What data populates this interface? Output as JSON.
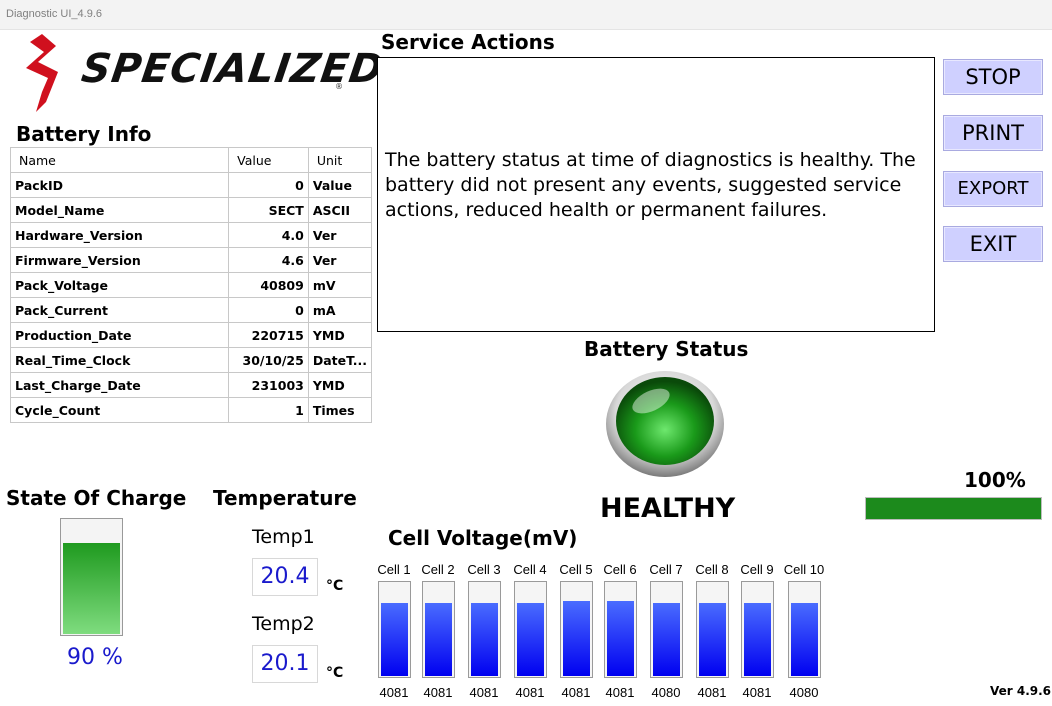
{
  "window": {
    "title": "Diagnostic UI_4.9.6"
  },
  "brand": {
    "name": "SPECIALIZED",
    "trademark": "®"
  },
  "battery_info": {
    "title": "Battery Info",
    "columns": [
      "Name",
      "Value",
      "Unit"
    ],
    "rows": [
      {
        "name": "PackID",
        "value": "0",
        "unit": "Value"
      },
      {
        "name": "Model_Name",
        "value": "SECT",
        "unit": "ASCII"
      },
      {
        "name": "Hardware_Version",
        "value": "4.0",
        "unit": "Ver"
      },
      {
        "name": "Firmware_Version",
        "value": "4.6",
        "unit": "Ver"
      },
      {
        "name": "Pack_Voltage",
        "value": "40809",
        "unit": "mV"
      },
      {
        "name": "Pack_Current",
        "value": "0",
        "unit": "mA"
      },
      {
        "name": "Production_Date",
        "value": "220715",
        "unit": "YMD"
      },
      {
        "name": "Real_Time_Clock",
        "value": "30/10/25",
        "unit": "DateT..."
      },
      {
        "name": "Last_Charge_Date",
        "value": "231003",
        "unit": "YMD"
      },
      {
        "name": "Cycle_Count",
        "value": "1",
        "unit": "Times"
      }
    ]
  },
  "service_actions": {
    "title": "Service Actions",
    "text": "The battery status at time of diagnostics is healthy. The battery did not present any events, suggested service actions, reduced health or permanent failures."
  },
  "buttons": {
    "stop": "STOP",
    "print": "PRINT",
    "export": "EXPORT",
    "exit": "EXIT"
  },
  "battery_status": {
    "title": "Battery Status",
    "state": "HEALTHY",
    "light_color": "#1a9a1a"
  },
  "progress": {
    "label": "100%",
    "value": 1.0,
    "color": "#1c8a1c"
  },
  "state_of_charge": {
    "title": "State Of Charge",
    "label": "90 %",
    "value": 0.9
  },
  "temperature": {
    "title": "Temperature",
    "sensors": [
      {
        "label": "Temp1",
        "value": "20.4",
        "unit": "°C"
      },
      {
        "label": "Temp2",
        "value": "20.1",
        "unit": "°C"
      }
    ]
  },
  "cell_voltage": {
    "title": "Cell Voltage(mV)",
    "cells": [
      {
        "name": "Cell 1",
        "value": "4081"
      },
      {
        "name": "Cell 2",
        "value": "4081"
      },
      {
        "name": "Cell 3",
        "value": "4081"
      },
      {
        "name": "Cell 4",
        "value": "4081"
      },
      {
        "name": "Cell 5",
        "value": "4081"
      },
      {
        "name": "Cell 6",
        "value": "4081"
      },
      {
        "name": "Cell 7",
        "value": "4080"
      },
      {
        "name": "Cell 8",
        "value": "4081"
      },
      {
        "name": "Cell 9",
        "value": "4081"
      },
      {
        "name": "Cell 10",
        "value": "4080"
      }
    ]
  },
  "version": "Ver 4.9.6"
}
